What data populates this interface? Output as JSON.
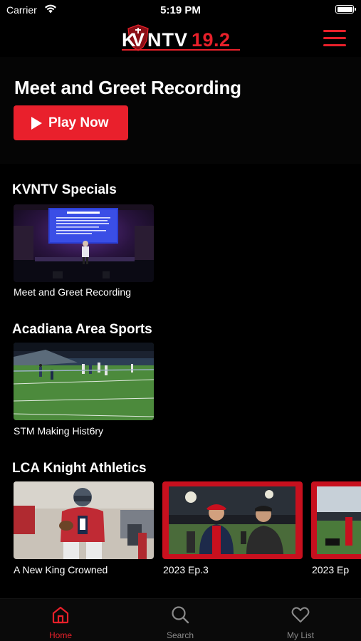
{
  "status_bar": {
    "carrier": "Carrier",
    "time": "5:19 PM"
  },
  "header": {
    "logo_text": "KVNTV19.2",
    "accent_color": "#e8202a"
  },
  "hero": {
    "title": "Meet and Greet Recording",
    "play_label": "Play Now"
  },
  "sections": [
    {
      "title": "KVNTV Specials",
      "items": [
        {
          "caption": "Meet and Greet Recording"
        }
      ]
    },
    {
      "title": "Acadiana Area Sports",
      "items": [
        {
          "caption": "STM Making Hist6ry"
        }
      ]
    },
    {
      "title": "LCA Knight Athletics",
      "items": [
        {
          "caption": "A New King Crowned"
        },
        {
          "caption": "2023 Ep.3"
        },
        {
          "caption": "2023 Ep"
        }
      ]
    }
  ],
  "tabs": [
    {
      "label": "Home",
      "icon": "home-icon",
      "active": true
    },
    {
      "label": "Search",
      "icon": "search-icon",
      "active": false
    },
    {
      "label": "My List",
      "icon": "heart-icon",
      "active": false
    }
  ]
}
